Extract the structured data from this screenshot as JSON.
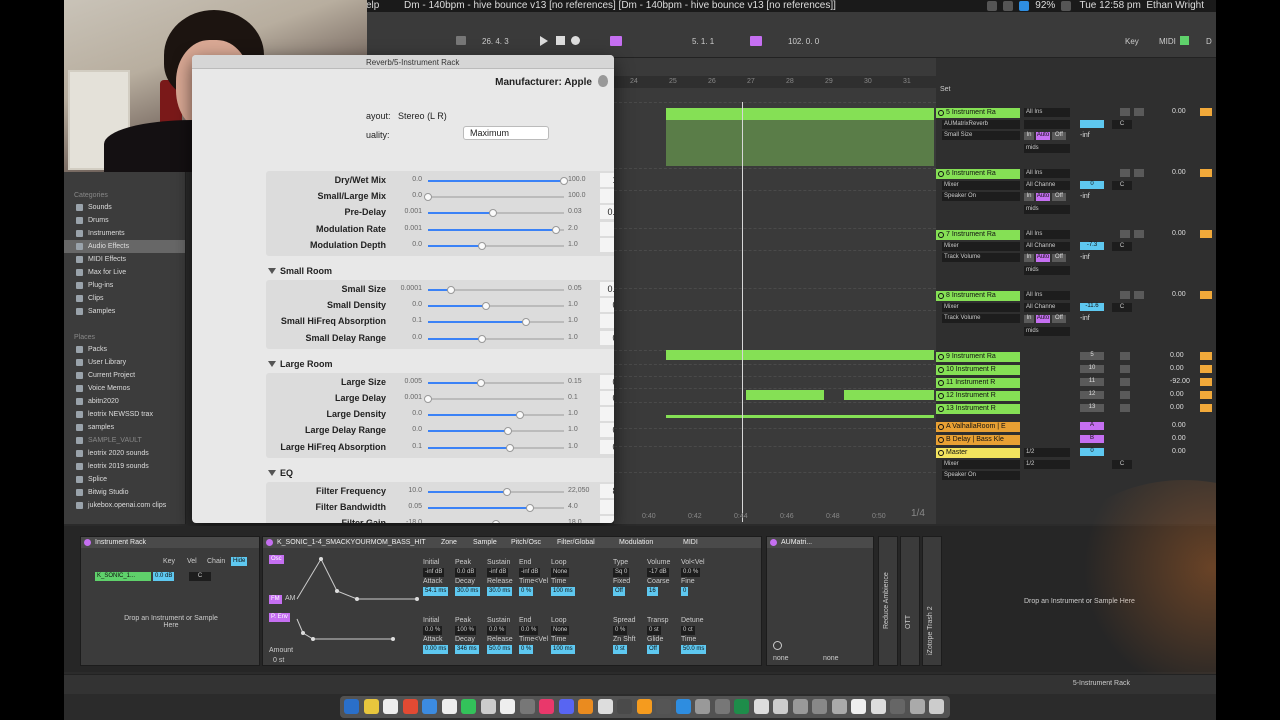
{
  "menubar": {
    "help_fragment": "elp",
    "window_title": "Dm - 140bpm - hive bounce v13  [no references]   [Dm - 140bpm - hive bounce v13  [no references]]",
    "battery": "92%",
    "clock": "Tue 12:58 pm",
    "user": "Ethan Wright"
  },
  "transport": {
    "arrangement_position": "26.  4.  3",
    "loop_start": "5.  1.  1",
    "loop_length": "102.  0.  0",
    "key_label": "Key",
    "midi_label": "MIDI",
    "d_label": "D"
  },
  "browser": {
    "categories_header": "Categories",
    "categories": [
      {
        "label": "Sounds",
        "icon": "sounds-icon"
      },
      {
        "label": "Drums",
        "icon": "drums-icon"
      },
      {
        "label": "Instruments",
        "icon": "instruments-icon"
      },
      {
        "label": "Audio Effects",
        "icon": "audio-effects-icon",
        "selected": true
      },
      {
        "label": "MIDI Effects",
        "icon": "midi-effects-icon"
      },
      {
        "label": "Max for Live",
        "icon": "max-icon"
      },
      {
        "label": "Plug-ins",
        "icon": "plugins-icon"
      },
      {
        "label": "Clips",
        "icon": "clips-icon"
      },
      {
        "label": "Samples",
        "icon": "samples-icon"
      }
    ],
    "places_header": "Places",
    "places": [
      {
        "label": "Packs"
      },
      {
        "label": "User Library"
      },
      {
        "label": "Current Project"
      },
      {
        "label": "Voice Memos"
      },
      {
        "label": "abitn2020"
      },
      {
        "label": "leotrix NEWSSD trax"
      },
      {
        "label": "samples"
      },
      {
        "label": "SAMPLE_VAULT",
        "dim": true
      },
      {
        "label": "leotrix 2020 sounds"
      },
      {
        "label": "leotrix 2019 sounds"
      },
      {
        "label": "Splice"
      },
      {
        "label": "Bitwig Studio"
      },
      {
        "label": "jukebox.openai.com clips"
      }
    ]
  },
  "plugin": {
    "title": "Reverb/5-Instrument Rack",
    "manufacturer": "Manufacturer: Apple",
    "layout_label": "ayout:",
    "layout_value": "Stereo (L R)",
    "quality_label": "uality:",
    "quality_value": "Maximum",
    "sections": [
      {
        "name": "",
        "params": [
          {
            "label": "Dry/Wet Mix",
            "min": "0.0",
            "max": "100.0",
            "value": "100.0",
            "unit": "%",
            "pos": 1.0
          },
          {
            "label": "Small/Large Mix",
            "min": "0.0",
            "max": "100.0",
            "value": "0.0",
            "unit": "%",
            "pos": 0.0
          },
          {
            "label": "Pre-Delay",
            "min": "0.001",
            "max": "0.03",
            "value": "0.0149",
            "unit": "Secs",
            "pos": 0.48
          },
          {
            "label": "Modulation Rate",
            "min": "0.001",
            "max": "2.0",
            "value": "1.23",
            "unit": "Hz",
            "pos": 0.94
          },
          {
            "label": "Modulation Depth",
            "min": "0.0",
            "max": "1.0",
            "value": "0.4",
            "unit": "",
            "pos": 0.4
          }
        ]
      },
      {
        "name": "Small Room",
        "params": [
          {
            "label": "Small Size",
            "min": "0.0001",
            "max": "0.05",
            "value": "0.0085",
            "unit": "Secs",
            "pos": 0.17
          },
          {
            "label": "Small Density",
            "min": "0.0",
            "max": "1.0",
            "value": "0.431",
            "unit": "",
            "pos": 0.43
          },
          {
            "label": "Small HiFreq Absorption",
            "min": "0.1",
            "max": "1.0",
            "value": "0.75",
            "unit": "",
            "pos": 0.72
          },
          {
            "label": "Small Delay Range",
            "min": "0.0",
            "max": "1.0",
            "value": "0.396",
            "unit": "",
            "pos": 0.4
          }
        ]
      },
      {
        "name": "Large Room",
        "params": [
          {
            "label": "Large Size",
            "min": "0.005",
            "max": "0.15",
            "value": "0.061",
            "unit": "Secs",
            "pos": 0.39
          },
          {
            "label": "Large Delay",
            "min": "0.001",
            "max": "0.1",
            "value": "0.001",
            "unit": "Secs",
            "pos": 0.0
          },
          {
            "label": "Large Density",
            "min": "0.0",
            "max": "1.0",
            "value": "0.68",
            "unit": "",
            "pos": 0.68
          },
          {
            "label": "Large Delay Range",
            "min": "0.0",
            "max": "1.0",
            "value": "0.585",
            "unit": "",
            "pos": 0.585
          },
          {
            "label": "Large HiFreq Absorption",
            "min": "0.1",
            "max": "1.0",
            "value": "0.641",
            "unit": "",
            "pos": 0.6
          }
        ]
      },
      {
        "name": "EQ",
        "params": [
          {
            "label": "Filter Frequency",
            "min": "10.0",
            "max": "22,050",
            "value": "800.0",
            "unit": "Hz",
            "pos": 0.58
          },
          {
            "label": "Filter Bandwidth",
            "min": "0.05",
            "max": "4.0",
            "value": "3.0",
            "unit": "8ve",
            "pos": 0.75
          },
          {
            "label": "Filter Gain",
            "min": "-18.0",
            "max": "18.0",
            "value": "0.0",
            "unit": "dB",
            "pos": 0.5
          }
        ]
      }
    ]
  },
  "arrangement": {
    "bars": [
      "24",
      "25",
      "26",
      "27",
      "28",
      "29",
      "30",
      "31"
    ],
    "times": [
      "0:40",
      "0:42",
      "0:44",
      "0:46",
      "0:48",
      "0:50"
    ],
    "page": "1/4",
    "set_label": "Set"
  },
  "mixer": {
    "tracks": [
      {
        "name": "5 Instrument Ra",
        "input": "All Ins",
        "device": "AUMatrixReverb",
        "param": "Small Size",
        "channel": "",
        "vol": "",
        "pan": "C",
        "send": "-inf",
        "right_value": "0.00"
      },
      {
        "name": "6 Instrument Ra",
        "input": "All Ins",
        "device": "Mixer",
        "param": "Speaker On",
        "channel": "All Channe",
        "vol": "0",
        "pan": "C",
        "send": "-inf",
        "right_value": "0.00"
      },
      {
        "name": "7 Instrument Ra",
        "input": "All Ins",
        "device": "Mixer",
        "param": "Track Volume",
        "channel": "All Channe",
        "vol": "-7.3",
        "pan": "C",
        "send": "-inf",
        "right_value": "0.00"
      },
      {
        "name": "8 Instrument Ra",
        "input": "All Ins",
        "device": "Mixer",
        "param": "Track Volume",
        "channel": "All Channe",
        "vol": "-11.6",
        "pan": "C",
        "send": "-inf",
        "right_value": "0.00"
      }
    ],
    "in_label": "In",
    "auto_label": "Auto",
    "off_label": "Off",
    "mids_label": "mids",
    "collapsed": [
      {
        "name": "9 Instrument Ra",
        "vol": "5",
        "right_value": "0.00"
      },
      {
        "name": "10 Instrument R",
        "vol": "10",
        "right_value": "0.00"
      },
      {
        "name": "11 Instrument R",
        "vol": "11",
        "right_value": "-92.00"
      },
      {
        "name": "12 Instrument R",
        "vol": "12",
        "right_value": "0.00"
      },
      {
        "name": "13 Instrument R",
        "vol": "13",
        "right_value": "0.00"
      }
    ],
    "returns": [
      {
        "name": "A ValhallaRoom | E",
        "send": "A",
        "right_value": "0.00"
      },
      {
        "name": "B Delay | Bass Kle",
        "send": "B",
        "right_value": "0.00"
      }
    ],
    "master": {
      "name": "Master",
      "device": "Mixer",
      "param": "Speaker On",
      "cue": "1/2",
      "cue2": "1/2",
      "vol": "0",
      "pan": "C",
      "right_value": "0.00"
    }
  },
  "devices": {
    "rack_title": "Instrument Rack",
    "rack_chain": "K_SONIC_1...",
    "rack_vol": "0.0 dB",
    "rack_pan": "C",
    "rack_cols": [
      "Key",
      "Vel",
      "Chain",
      "Hide"
    ],
    "rack_drop": "Drop an Instrument or Sample Here",
    "sampler_title": "K_SONIC_1-4_SMACKYOURMOM_BASS_HIT",
    "sampler_tabs": [
      "Zone",
      "Sample",
      "Pitch/Osc",
      "Filter/Global",
      "Modulation",
      "MIDI"
    ],
    "osc_label": "Osc",
    "fm_label": "FM",
    "am_label": "AM",
    "penv_label": "P. Env",
    "amount_label": "Amount",
    "amount_value": "0 st",
    "env1": {
      "headers": [
        "Initial",
        "Peak",
        "Sustain",
        "End",
        "Loop"
      ],
      "values": [
        "-inf dB",
        "0.0 dB",
        "-inf dB",
        "-inf dB",
        "None"
      ],
      "headers2": [
        "Attack",
        "Decay",
        "Release",
        "Time<Vel",
        "Time"
      ],
      "values2": [
        "54.1 ms",
        "30.0 ms",
        "30.0 ms",
        "0 %",
        "100 ms"
      ]
    },
    "voice": {
      "headers": [
        "Type",
        "Volume",
        "Vol<Vel"
      ],
      "values": [
        "Sq 0",
        "-17 dB",
        "0.0 %"
      ],
      "headers2": [
        "Fixed",
        "Coarse",
        "Fine"
      ],
      "values2": [
        "Off",
        "16",
        "0"
      ]
    },
    "env2": {
      "headers": [
        "Initial",
        "Peak",
        "Sustain",
        "End",
        "Loop"
      ],
      "values": [
        "0.0 %",
        "100 %",
        "0.0 %",
        "0.0 %",
        "None"
      ],
      "headers2": [
        "Attack",
        "Decay",
        "Release",
        "Time<Vel",
        "Time"
      ],
      "values2": [
        "0.00 ms",
        "346 ms",
        "50.0 ms",
        "0 %",
        "100 ms"
      ]
    },
    "pitch": {
      "headers": [
        "Spread",
        "Transp",
        "Detune"
      ],
      "values": [
        "0 %",
        "0 st",
        "0 ct"
      ],
      "headers2": [
        "Zn Shft",
        "Glide",
        "Time"
      ],
      "values2": [
        "0 st",
        "Off",
        "50.0 ms"
      ]
    },
    "au_title": "AUMatri...",
    "au_sel1": "none",
    "au_sel2": "none",
    "rotated": [
      "Reduce Ambience",
      "OTT",
      "iZotope Trash 2"
    ],
    "right_drop": "Drop an Instrument or Sample Here"
  },
  "statusbar": {
    "track_name": "5-Instrument Rack"
  }
}
